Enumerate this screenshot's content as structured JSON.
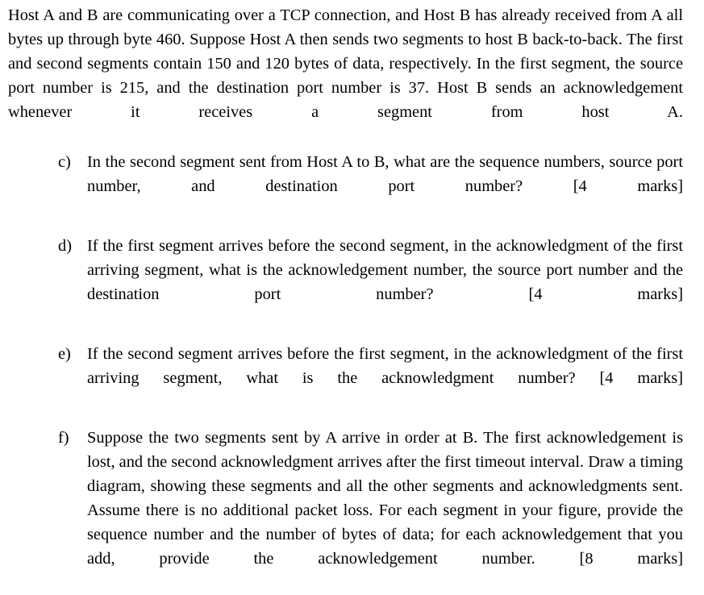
{
  "document": {
    "intro_paragraph": "Host A and B are communicating over a TCP connection, and Host B has already received from A all bytes up through byte 460. Suppose Host A then sends two segments to host B back-to-back. The first and second segments contain 150 and 120 bytes of data, respectively. In the first segment, the source port number is 215, and the destination port number is 37. Host B sends an acknowledgement whenever it receives a segment from host A.",
    "questions": [
      {
        "marker": "c)",
        "text": "In the second segment sent from Host A to B, what are the sequence numbers, source port number, and destination port number? [4 marks]",
        "marks": "4 marks"
      },
      {
        "marker": "d)",
        "text": "If the first segment arrives before the second segment, in the acknowledgment of the first arriving segment, what is the acknowledgement number, the source port number and the destination port number? [4 marks]",
        "marks": "4 marks"
      },
      {
        "marker": "e)",
        "text": " If the second segment arrives before the first segment, in the acknowledgment of the first arriving segment, what is the acknowledgment number? [4 marks]",
        "marks": "4 marks"
      },
      {
        "marker": "f)",
        "text": "Suppose the two segments sent by A arrive in order at B. The first acknowledgement is lost, and the second acknowledgment arrives after the first timeout interval. Draw a timing diagram, showing these segments and all the other segments and acknowledgments sent. Assume there is no additional packet loss. For each segment in your figure, provide the sequence number and the number of bytes of data; for each acknowledgement that you add, provide the acknowledgement number. [8 marks]",
        "marks": "8 marks"
      }
    ]
  }
}
